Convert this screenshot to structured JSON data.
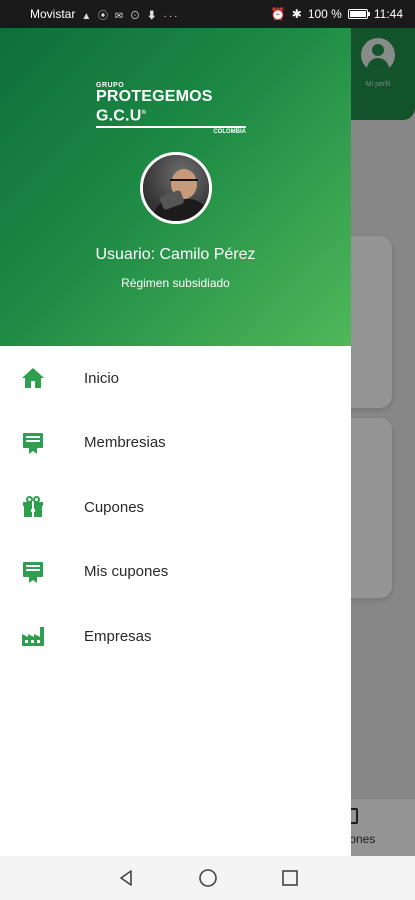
{
  "status_bar": {
    "carrier": "Movistar",
    "left_icons": "▲ ⦿ ✉ ⊙ ⬇ ···",
    "battery_percent": "100 %",
    "time": "11:44",
    "battery_level": 1.0
  },
  "background_app": {
    "profile_label": "Mi perfil",
    "bottom_nav_label": "iciones"
  },
  "drawer": {
    "logo": {
      "grupo": "GRUPO",
      "name": "PROTEGEMOS G.C.U",
      "registered": "®",
      "country": "COLOMBIA"
    },
    "user_name": "Usuario: Camilo Pérez",
    "user_regime": "Régimen subsidiado",
    "menu": [
      {
        "label": "Inicio",
        "icon": "home-icon"
      },
      {
        "label": "Membresias",
        "icon": "membership-icon"
      },
      {
        "label": "Cupones",
        "icon": "gift-icon"
      },
      {
        "label": "Mis cupones",
        "icon": "my-coupons-icon"
      },
      {
        "label": "Empresas",
        "icon": "factory-icon"
      }
    ],
    "accent_color": "#2e9e4f",
    "header_gradient": [
      "#0f6e3a",
      "#4fb85a"
    ]
  }
}
